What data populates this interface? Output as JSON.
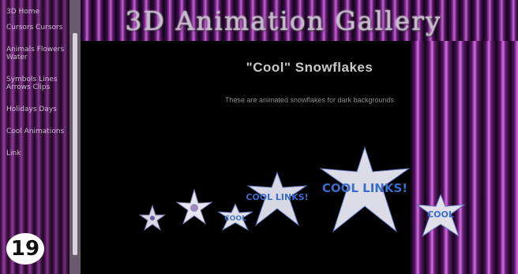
{
  "banner": {
    "title": "3D Animation Gallery"
  },
  "sidebar": {
    "items": [
      {
        "label": "3D Home"
      },
      {
        "label": "Cursors Cursors"
      },
      {
        "label": "Animals Flowers Water"
      },
      {
        "label": "Symbols Lines Arrows Clips"
      },
      {
        "label": "Holidays Days"
      },
      {
        "label": "Cool Animations"
      },
      {
        "label": "Link"
      }
    ]
  },
  "main": {
    "heading": "\"Cool\" Snowflakes",
    "subtext": "These are animated snowflakes for dark backgrounds",
    "flakes": [
      {
        "text": ""
      },
      {
        "text": ""
      },
      {
        "text": "COOL"
      },
      {
        "text": "COOL LINKS!"
      },
      {
        "text": "COOL LINKS!"
      },
      {
        "text": "COOL"
      }
    ]
  },
  "badge": {
    "number": "19"
  },
  "colors": {
    "accent": "#b04cc0",
    "curtain": "#7c2a86",
    "text": "#c9c9c9"
  }
}
